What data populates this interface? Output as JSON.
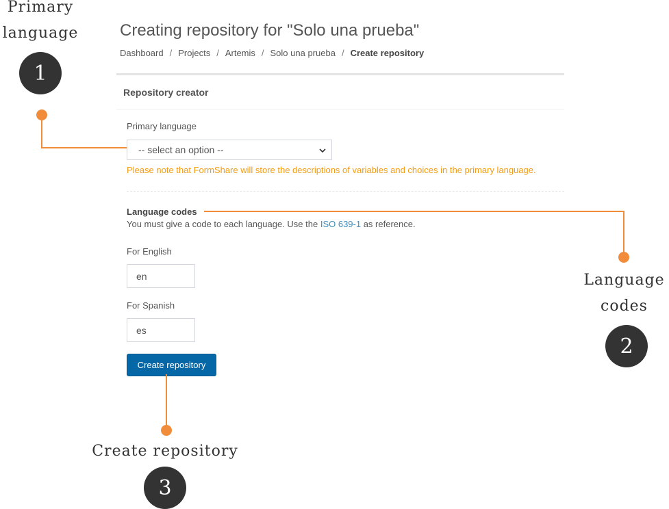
{
  "page": {
    "title": "Creating repository for \"Solo una prueba\"",
    "breadcrumb": [
      "Dashboard",
      "Projects",
      "Artemis",
      "Solo una prueba",
      "Create repository"
    ],
    "breadcrumb_separator": "/"
  },
  "panel": {
    "title": "Repository creator",
    "primary_language": {
      "label": "Primary language",
      "selected": "-- select an option --",
      "note": "Please note that FormShare will store the descriptions of variables and choices in the primary language."
    },
    "language_codes": {
      "title": "Language codes",
      "help_before": "You must give a code to each language. Use the ",
      "help_link": "ISO 639-1",
      "help_after": " as reference.",
      "fields": [
        {
          "label": "For English",
          "value": "en"
        },
        {
          "label": "For Spanish",
          "value": "es"
        }
      ]
    },
    "submit_label": "Create repository"
  },
  "annotations": [
    {
      "number": "1",
      "line1": "Primary",
      "line2": "language"
    },
    {
      "number": "2",
      "line1": "Language",
      "line2": "codes"
    },
    {
      "number": "3",
      "line1": "Create repository"
    }
  ],
  "colors": {
    "accent": "#0567a6",
    "warning": "#f39c12",
    "callout": "#f08c3a",
    "badge": "#333333",
    "link": "#3c8dbc"
  }
}
